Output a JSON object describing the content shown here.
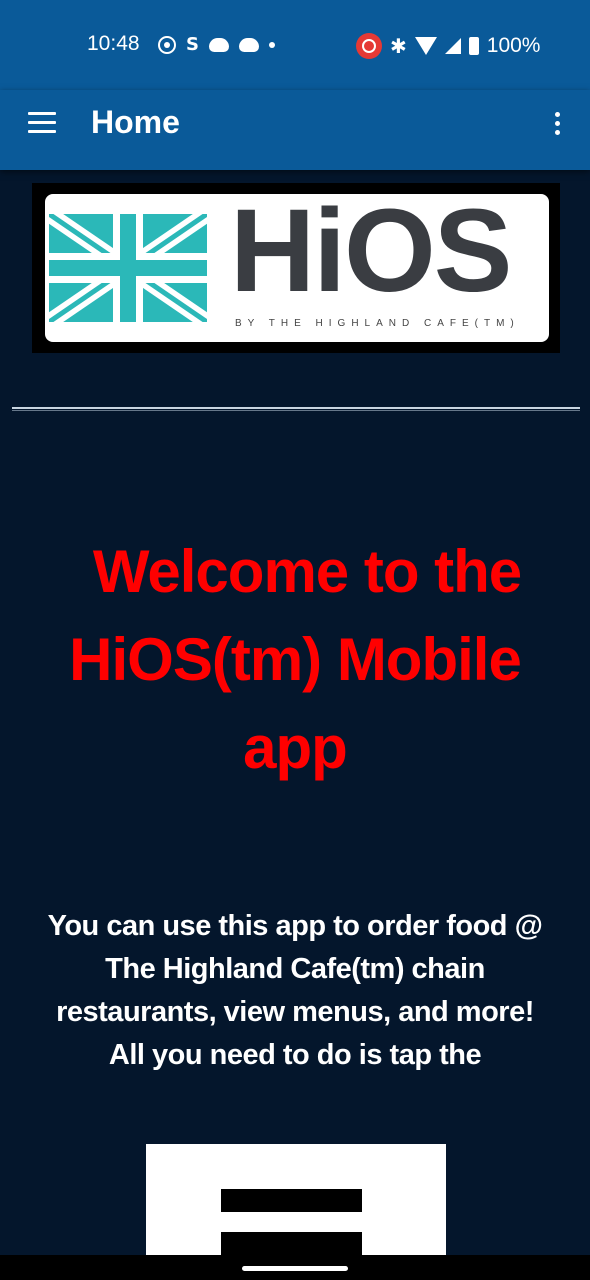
{
  "status_bar": {
    "time": "10:48",
    "battery": "100%",
    "icons_left": [
      "media-icon",
      "s-icon",
      "reddit-icon",
      "reddit-icon",
      "dot-icon"
    ],
    "icons_right": [
      "screen-record-icon",
      "bluetooth-icon",
      "wifi-icon",
      "signal-icon",
      "battery-icon"
    ]
  },
  "app_bar": {
    "title": "Home",
    "menu_icon": "hamburger-menu-icon",
    "overflow_icon": "more-vert-icon",
    "color": "#0a5a99"
  },
  "logo": {
    "wordmark": "HiOS",
    "tagline": "BY THE HIGHLAND CAFE(TM)"
  },
  "welcome": {
    "line1": "Welcome to the",
    "line2": "HiOS(tm) Mobile",
    "line3": "app",
    "color": "#ff0000"
  },
  "description": {
    "line1": "You can use this app to order food @",
    "line2": "The Highland Cafe(tm) chain",
    "line3": "restaurants, view menus, and more!",
    "line4": "All you need to do is tap the"
  },
  "colors": {
    "background": "#04162c",
    "flag": "#2bb8b8"
  }
}
